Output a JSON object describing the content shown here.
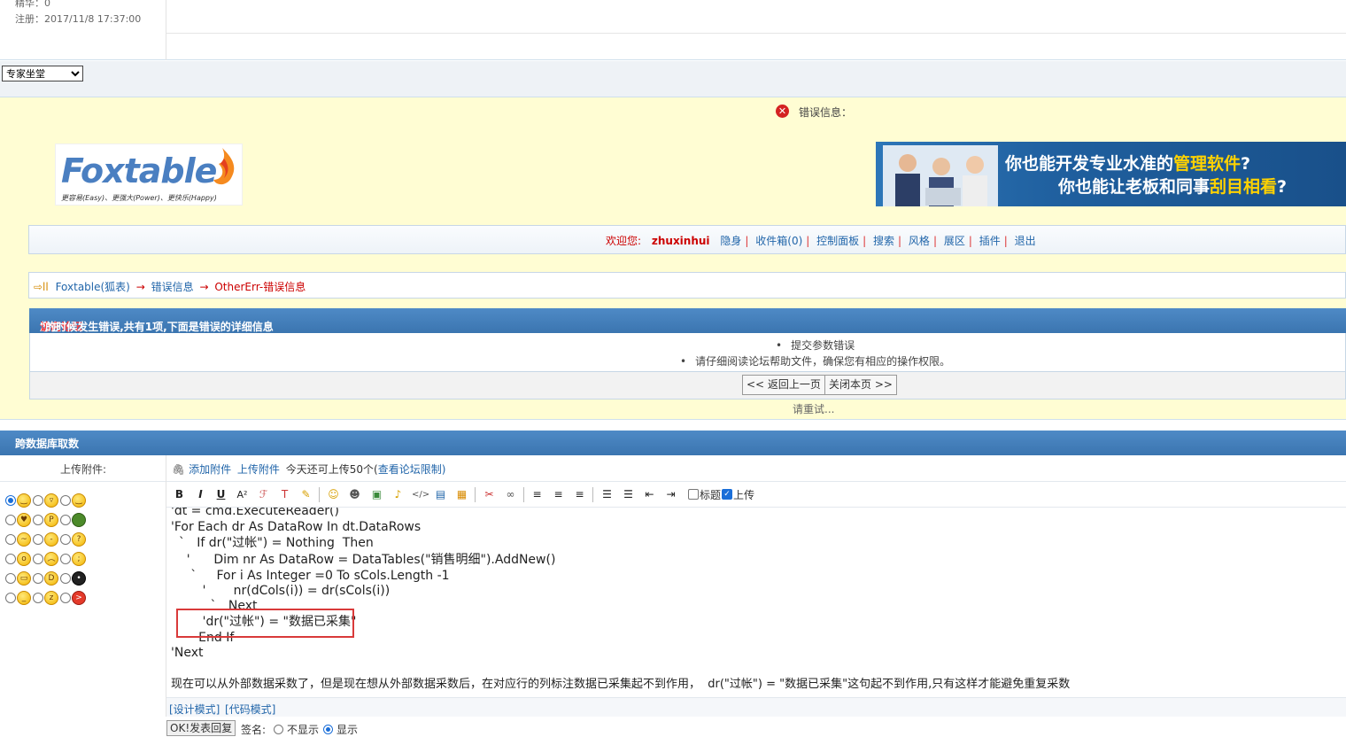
{
  "user_info": {
    "essence": "精华：0",
    "register": "注册：2017/11/8 17:37:00"
  },
  "jump": {
    "selected": "专家坐堂"
  },
  "error": {
    "title": "错误信息：",
    "logo_name": "Foxtable",
    "logo_tagline": "更容易(Easy)、更强大(Power)、更快乐(Happy)",
    "banner_line1_a": "你也能开发专业水准的",
    "banner_line1_hl": "管理软件",
    "banner_line1_b": "?",
    "banner_line2_a": "你也能让老板和同事",
    "banner_line2_hl": "刮目相看",
    "banner_line2_b": "?"
  },
  "nav": {
    "welcome": "欢迎您:",
    "username": "zhuxinhui",
    "items": [
      "隐身",
      "收件箱(0)",
      "控制面板",
      "搜索",
      "风格",
      "展区",
      "插件",
      "退出"
    ]
  },
  "breadcrumb": {
    "icon": "⇨ll",
    "items": [
      "Foxtable(狐表)",
      "错误信息",
      "OtherErr-错误信息"
    ],
    "arrow": "→"
  },
  "error_detail": {
    "head_a": "您在\"",
    "head_hot": "访问论坛",
    "head_b": "\"的时候发生错误,共有1项,下面是错误的详细信息",
    "reasons": [
      "提交参数错误",
      "请仔细阅读论坛帮助文件，确保您有相应的操作权限。"
    ],
    "back_button": "<< 返回上一页",
    "close_button": "关闭本页 >>",
    "retry": "请重试..."
  },
  "form": {
    "title": "跨数据库取数",
    "upload_label": "上传附件:",
    "add_attachment": "添加附件",
    "upload_attachment": "上传附件",
    "today_limit": "今天还可上传50个(",
    "view_limit": "查看论坛限制",
    "close_paren": ")",
    "title_checkbox": "标题",
    "upload_checkbox": "上传",
    "design_mode": "[设计模式]",
    "code_mode": "[代码模式]",
    "submit": "OK!发表回复",
    "sign_label": "签名:",
    "sign_hide": "不显示",
    "sign_show": "显示"
  },
  "code_lines": [
    "'dt = cmd.ExecuteReader()",
    "'For Each dr As DataRow In dt.DataRows",
    "  `   If dr(\"过帐\") = Nothing  Then",
    "    '      Dim nr As DataRow = DataTables(\"销售明细\").AddNew()",
    "     `     For i As Integer =0 To sCols.Length -1",
    "        '       nr(dCols(i)) = dr(sCols(i))",
    "          `   Next",
    "        'dr(\"过帐\") = \"数据已采集\"",
    "       End If",
    "'Next",
    "",
    "现在可以从外部数据采数了，但是现在想从外部数据采数后，在对应行的列标注数据已采集起不到作用，  dr(\"过帐\") = \"数据已采集\"这句起不到作用,只有这样才能避免重复采数"
  ]
}
